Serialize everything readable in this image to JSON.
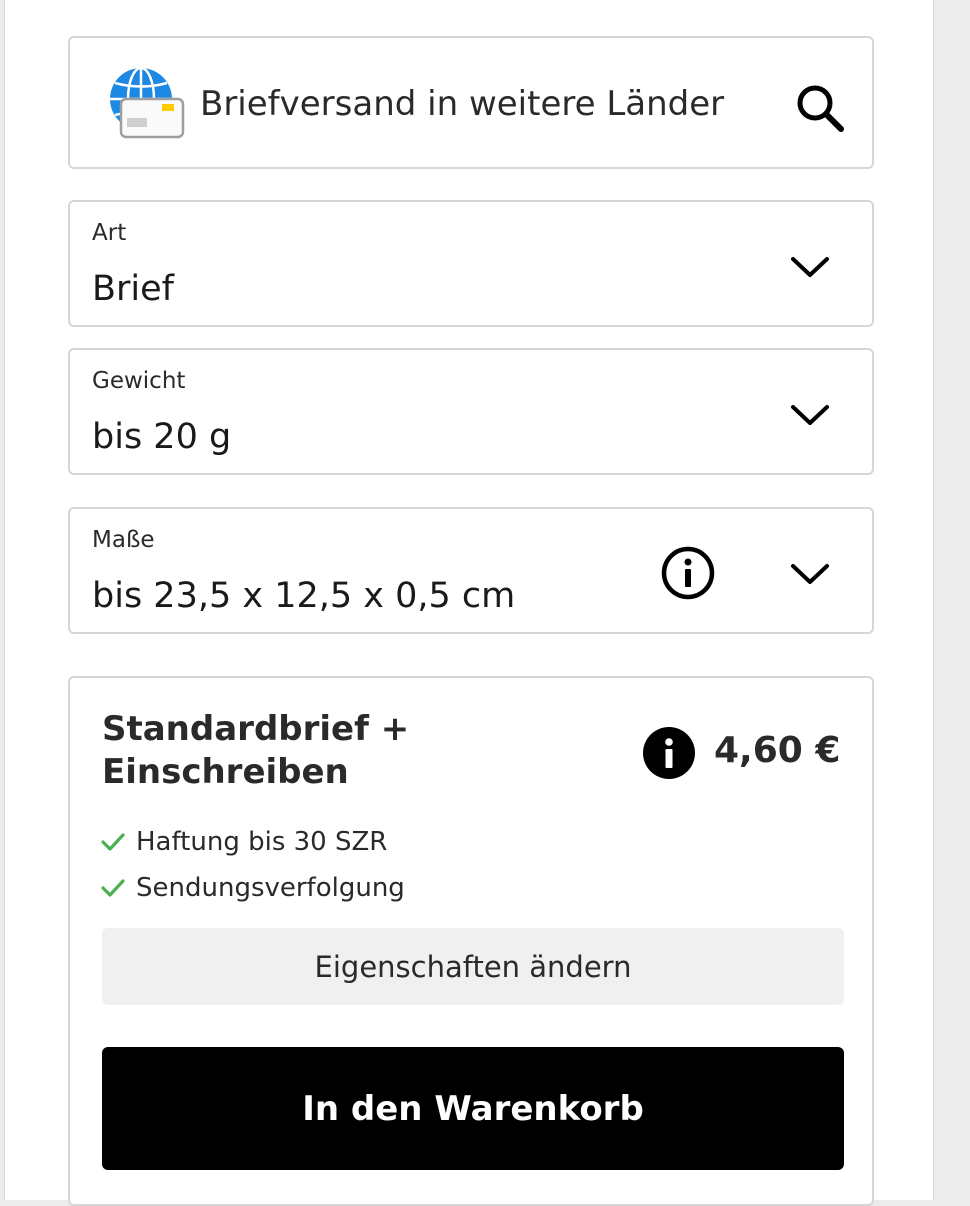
{
  "search": {
    "value": "Briefversand in weitere Länder",
    "icon": "search-icon",
    "globe_icon": "globe-envelope-icon"
  },
  "fields": {
    "art": {
      "label": "Art",
      "value": "Brief"
    },
    "gewicht": {
      "label": "Gewicht",
      "value": "bis 20 g"
    },
    "masse": {
      "label": "Maße",
      "value": "bis 23,5 x 12,5 x 0,5 cm"
    }
  },
  "product": {
    "title_line1": "Standardbrief +",
    "title_line2": "Einschreiben",
    "price": "4,60 €",
    "features": [
      "Haftung bis 30 SZR",
      "Sendungsverfolgung"
    ],
    "change_button": "Eigenschaften ändern",
    "cart_button": "In den Warenkorb"
  },
  "colors": {
    "check": "#4caf50",
    "globe_blue": "#1e88e5",
    "chip_yellow": "#ffcc00",
    "primary_button": "#000000"
  }
}
